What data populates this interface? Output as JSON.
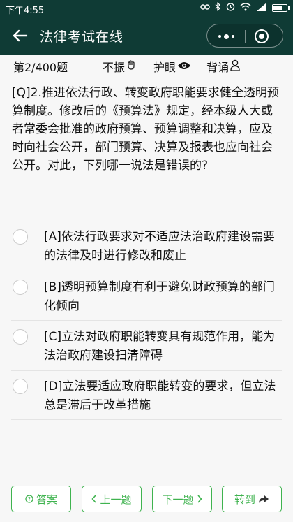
{
  "status": {
    "time": "下午4:55",
    "icons": [
      "link-icon",
      "bluetooth-icon",
      "alarm-icon",
      "wifi-icon",
      "signal-icon",
      "battery-icon"
    ]
  },
  "nav": {
    "title": "法律考试在线"
  },
  "info": {
    "count": "第2/400题",
    "skip": "不振",
    "eye_mode": "护眼",
    "recite": "背诵"
  },
  "question": {
    "text": "[Q]2.推进依法行政、转变政府职能要求健全透明预算制度。修改后的《预算法》规定，经本级人大或者常委会批准的政府预算、预算调整和决算，应及时向社会公开，部门预算、决算及报表也应向社会公开。对此，下列哪一说法是错误的?"
  },
  "options": [
    {
      "label": "[A]依法行政要求对不适应法治政府建设需要的法律及时进行修改和废止"
    },
    {
      "label": "[B]透明预算制度有利于避免财政预算的部门化倾向"
    },
    {
      "label": "[C]立法对政府职能转变具有规范作用，能为法治政府建设扫清障碍"
    },
    {
      "label": "[D]立法要适应政府职能转变的要求，但立法总是滞后于改革措施"
    }
  ],
  "footer": {
    "answer": "答案",
    "prev": "上一题",
    "next": "下一题",
    "goto": "转到"
  },
  "colors": {
    "header": "#0f3b35",
    "accent": "#3fb34f"
  }
}
